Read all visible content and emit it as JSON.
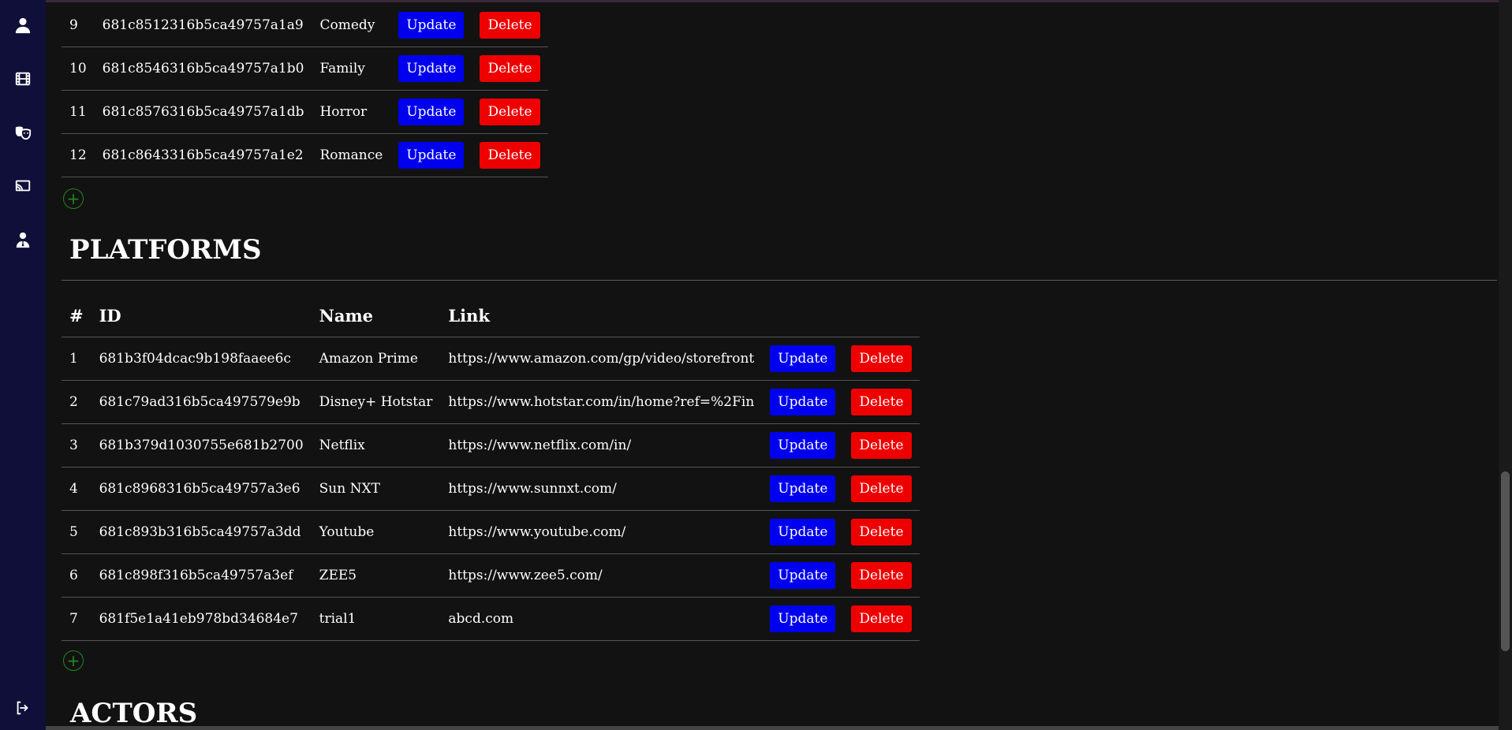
{
  "genres": {
    "rows": [
      {
        "num": "9",
        "id": "681c8512316b5ca49757a1a9",
        "name": "Comedy"
      },
      {
        "num": "10",
        "id": "681c8546316b5ca49757a1b0",
        "name": "Family"
      },
      {
        "num": "11",
        "id": "681c8576316b5ca49757a1db",
        "name": "Horror"
      },
      {
        "num": "12",
        "id": "681c8643316b5ca49757a1e2",
        "name": "Romance"
      }
    ]
  },
  "platforms": {
    "title": "PLATFORMS",
    "headers": {
      "num": "#",
      "id": "ID",
      "name": "Name",
      "link": "Link"
    },
    "rows": [
      {
        "num": "1",
        "id": "681b3f04dcac9b198faaee6c",
        "name": "Amazon Prime",
        "link": "https://www.amazon.com/gp/video/storefront"
      },
      {
        "num": "2",
        "id": "681c79ad316b5ca497579e9b",
        "name": "Disney+ Hotstar",
        "link": "https://www.hotstar.com/in/home?ref=%2Fin"
      },
      {
        "num": "3",
        "id": "681b379d1030755e681b2700",
        "name": "Netflix",
        "link": "https://www.netflix.com/in/"
      },
      {
        "num": "4",
        "id": "681c8968316b5ca49757a3e6",
        "name": "Sun NXT",
        "link": "https://www.sunnxt.com/"
      },
      {
        "num": "5",
        "id": "681c893b316b5ca49757a3dd",
        "name": "Youtube",
        "link": "https://www.youtube.com/"
      },
      {
        "num": "6",
        "id": "681c898f316b5ca49757a3ef",
        "name": "ZEE5",
        "link": "https://www.zee5.com/"
      },
      {
        "num": "7",
        "id": "681f5e1a41eb978bd34684e7",
        "name": "trial1",
        "link": "abcd.com"
      }
    ]
  },
  "actors": {
    "title": "ACTORS"
  },
  "buttons": {
    "update": "Update",
    "delete": "Delete",
    "add": "+"
  },
  "sidebar": {
    "icons": [
      "user-icon",
      "film-icon",
      "theater-masks-icon",
      "cast-screen-icon",
      "user-tie-icon",
      "logout-icon"
    ]
  },
  "colors": {
    "update": "#0000ee",
    "delete": "#ee0000",
    "add": "#1e8a1e",
    "sidebar": "#0f0f3a"
  }
}
